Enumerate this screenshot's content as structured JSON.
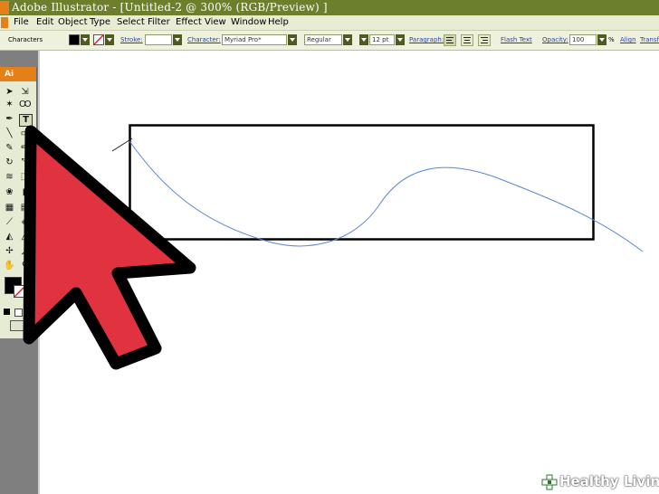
{
  "window": {
    "title": "Adobe Illustrator - [Untitled-2 @ 300% (RGB/Preview) ]"
  },
  "menu": [
    "File",
    "Edit",
    "Object",
    "Type",
    "Select",
    "Filter",
    "Effect",
    "View",
    "Window",
    "Help"
  ],
  "control_bar": {
    "panel_label": "Characters",
    "stroke_label": "Stroke:",
    "character_label": "Character:",
    "font_family": "Myriad Pro*",
    "font_style": "Regular",
    "font_size": "12 pt",
    "paragraph_label": "Paragraph:",
    "flash_text_label": "Flash Text",
    "opacity_label": "Opacity:",
    "opacity_value": "100",
    "percent_sign": "%",
    "align_label": "Align",
    "transform_label": "Transf"
  },
  "toolbox": {
    "tab_label": "Ai"
  },
  "watermark": {
    "text": "Healthy Living"
  },
  "colors": {
    "title_bar": "#6b7f2c",
    "menu_bg": "#e7ecd3",
    "control_bg": "#eef2dc",
    "cursor_fill": "#e0323f",
    "path_stroke": "#5b86d6",
    "ai_orange": "#e57f18"
  }
}
